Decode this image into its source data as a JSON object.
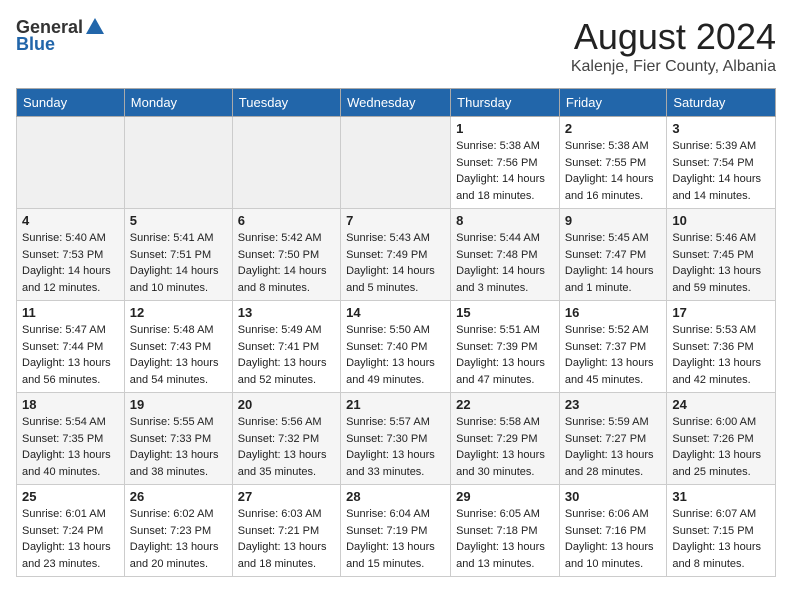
{
  "header": {
    "logo_general": "General",
    "logo_blue": "Blue",
    "month_year": "August 2024",
    "location": "Kalenje, Fier County, Albania"
  },
  "weekdays": [
    "Sunday",
    "Monday",
    "Tuesday",
    "Wednesday",
    "Thursday",
    "Friday",
    "Saturday"
  ],
  "weeks": [
    [
      {
        "day": "",
        "info": ""
      },
      {
        "day": "",
        "info": ""
      },
      {
        "day": "",
        "info": ""
      },
      {
        "day": "",
        "info": ""
      },
      {
        "day": "1",
        "info": "Sunrise: 5:38 AM\nSunset: 7:56 PM\nDaylight: 14 hours\nand 18 minutes."
      },
      {
        "day": "2",
        "info": "Sunrise: 5:38 AM\nSunset: 7:55 PM\nDaylight: 14 hours\nand 16 minutes."
      },
      {
        "day": "3",
        "info": "Sunrise: 5:39 AM\nSunset: 7:54 PM\nDaylight: 14 hours\nand 14 minutes."
      }
    ],
    [
      {
        "day": "4",
        "info": "Sunrise: 5:40 AM\nSunset: 7:53 PM\nDaylight: 14 hours\nand 12 minutes."
      },
      {
        "day": "5",
        "info": "Sunrise: 5:41 AM\nSunset: 7:51 PM\nDaylight: 14 hours\nand 10 minutes."
      },
      {
        "day": "6",
        "info": "Sunrise: 5:42 AM\nSunset: 7:50 PM\nDaylight: 14 hours\nand 8 minutes."
      },
      {
        "day": "7",
        "info": "Sunrise: 5:43 AM\nSunset: 7:49 PM\nDaylight: 14 hours\nand 5 minutes."
      },
      {
        "day": "8",
        "info": "Sunrise: 5:44 AM\nSunset: 7:48 PM\nDaylight: 14 hours\nand 3 minutes."
      },
      {
        "day": "9",
        "info": "Sunrise: 5:45 AM\nSunset: 7:47 PM\nDaylight: 14 hours\nand 1 minute."
      },
      {
        "day": "10",
        "info": "Sunrise: 5:46 AM\nSunset: 7:45 PM\nDaylight: 13 hours\nand 59 minutes."
      }
    ],
    [
      {
        "day": "11",
        "info": "Sunrise: 5:47 AM\nSunset: 7:44 PM\nDaylight: 13 hours\nand 56 minutes."
      },
      {
        "day": "12",
        "info": "Sunrise: 5:48 AM\nSunset: 7:43 PM\nDaylight: 13 hours\nand 54 minutes."
      },
      {
        "day": "13",
        "info": "Sunrise: 5:49 AM\nSunset: 7:41 PM\nDaylight: 13 hours\nand 52 minutes."
      },
      {
        "day": "14",
        "info": "Sunrise: 5:50 AM\nSunset: 7:40 PM\nDaylight: 13 hours\nand 49 minutes."
      },
      {
        "day": "15",
        "info": "Sunrise: 5:51 AM\nSunset: 7:39 PM\nDaylight: 13 hours\nand 47 minutes."
      },
      {
        "day": "16",
        "info": "Sunrise: 5:52 AM\nSunset: 7:37 PM\nDaylight: 13 hours\nand 45 minutes."
      },
      {
        "day": "17",
        "info": "Sunrise: 5:53 AM\nSunset: 7:36 PM\nDaylight: 13 hours\nand 42 minutes."
      }
    ],
    [
      {
        "day": "18",
        "info": "Sunrise: 5:54 AM\nSunset: 7:35 PM\nDaylight: 13 hours\nand 40 minutes."
      },
      {
        "day": "19",
        "info": "Sunrise: 5:55 AM\nSunset: 7:33 PM\nDaylight: 13 hours\nand 38 minutes."
      },
      {
        "day": "20",
        "info": "Sunrise: 5:56 AM\nSunset: 7:32 PM\nDaylight: 13 hours\nand 35 minutes."
      },
      {
        "day": "21",
        "info": "Sunrise: 5:57 AM\nSunset: 7:30 PM\nDaylight: 13 hours\nand 33 minutes."
      },
      {
        "day": "22",
        "info": "Sunrise: 5:58 AM\nSunset: 7:29 PM\nDaylight: 13 hours\nand 30 minutes."
      },
      {
        "day": "23",
        "info": "Sunrise: 5:59 AM\nSunset: 7:27 PM\nDaylight: 13 hours\nand 28 minutes."
      },
      {
        "day": "24",
        "info": "Sunrise: 6:00 AM\nSunset: 7:26 PM\nDaylight: 13 hours\nand 25 minutes."
      }
    ],
    [
      {
        "day": "25",
        "info": "Sunrise: 6:01 AM\nSunset: 7:24 PM\nDaylight: 13 hours\nand 23 minutes."
      },
      {
        "day": "26",
        "info": "Sunrise: 6:02 AM\nSunset: 7:23 PM\nDaylight: 13 hours\nand 20 minutes."
      },
      {
        "day": "27",
        "info": "Sunrise: 6:03 AM\nSunset: 7:21 PM\nDaylight: 13 hours\nand 18 minutes."
      },
      {
        "day": "28",
        "info": "Sunrise: 6:04 AM\nSunset: 7:19 PM\nDaylight: 13 hours\nand 15 minutes."
      },
      {
        "day": "29",
        "info": "Sunrise: 6:05 AM\nSunset: 7:18 PM\nDaylight: 13 hours\nand 13 minutes."
      },
      {
        "day": "30",
        "info": "Sunrise: 6:06 AM\nSunset: 7:16 PM\nDaylight: 13 hours\nand 10 minutes."
      },
      {
        "day": "31",
        "info": "Sunrise: 6:07 AM\nSunset: 7:15 PM\nDaylight: 13 hours\nand 8 minutes."
      }
    ]
  ]
}
